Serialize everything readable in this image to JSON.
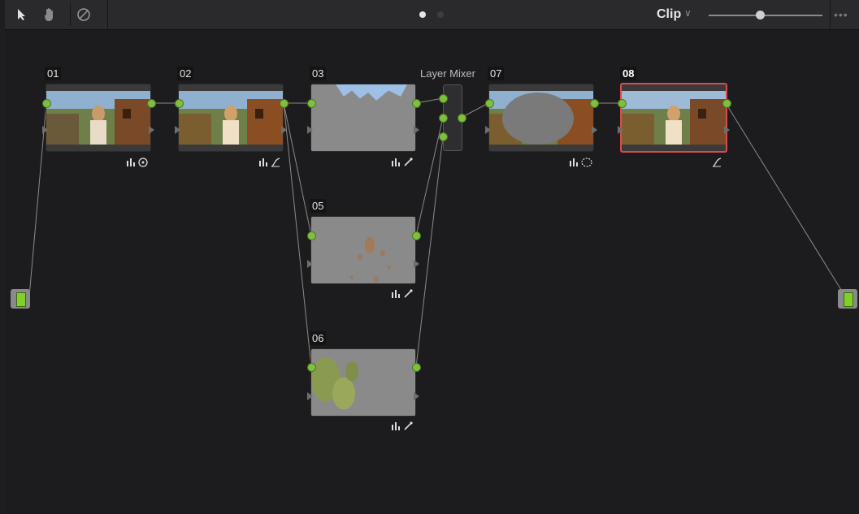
{
  "toolbar": {
    "pointer_icon": "pointer-arrow-icon",
    "hand_icon": "hand-pan-icon",
    "bypass_icon": "bypass-circle-slash-icon",
    "mode_label": "Clip",
    "menu_label": "•••"
  },
  "page_indicator": {
    "current": 1,
    "total": 2
  },
  "zoom_slider": {
    "value": 0.45
  },
  "mixer": {
    "label": "Layer Mixer"
  },
  "nodes": [
    {
      "id": "01",
      "selected": false,
      "badges": [
        "bars-icon",
        "circle-window-icon"
      ]
    },
    {
      "id": "02",
      "selected": false,
      "badges": [
        "bars-icon",
        "curves-icon"
      ]
    },
    {
      "id": "03",
      "selected": false,
      "badges": [
        "bars-icon",
        "eyedropper-icon"
      ]
    },
    {
      "id": "05",
      "selected": false,
      "badges": [
        "bars-icon",
        "eyedropper-icon"
      ]
    },
    {
      "id": "06",
      "selected": false,
      "badges": [
        "bars-icon",
        "eyedropper-icon"
      ]
    },
    {
      "id": "07",
      "selected": false,
      "badges": [
        "bars-icon",
        "dashed-circle-icon"
      ]
    },
    {
      "id": "08",
      "selected": true,
      "badges": [
        "curves-icon"
      ]
    }
  ],
  "colors": {
    "port_green": "#7fbf3f",
    "selected_border": "#d84c4c",
    "io_green": "#7fd02a"
  }
}
